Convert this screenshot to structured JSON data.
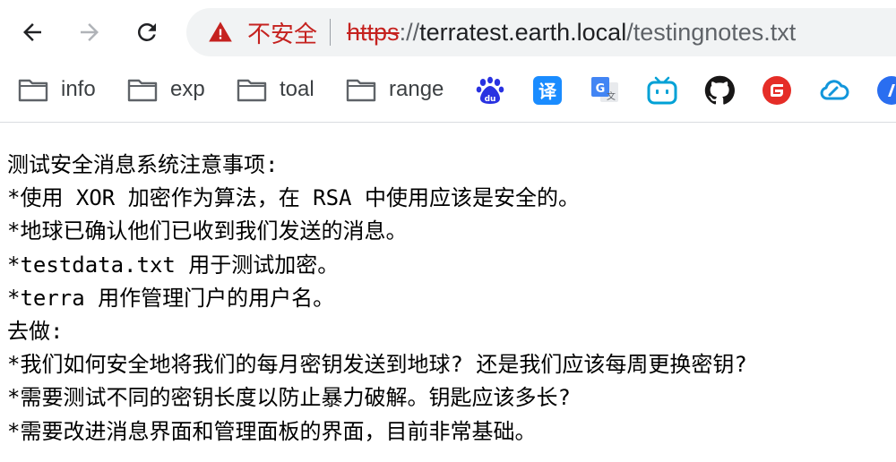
{
  "browser": {
    "security_label": "不安全",
    "url": {
      "scheme": "https",
      "separator": "://",
      "host": "terratest.earth.local",
      "path": "/testingnotes.txt"
    }
  },
  "bookmarks": {
    "folders": [
      {
        "label": "info"
      },
      {
        "label": "exp"
      },
      {
        "label": "toal"
      },
      {
        "label": "range"
      }
    ],
    "extensions": [
      "baidu-icon",
      "translate-icon",
      "google-translate-icon",
      "bilibili-icon",
      "github-icon",
      "gitee-icon",
      "cloud-icon",
      "partial-app-icon"
    ]
  },
  "document": {
    "lines": [
      "测试安全消息系统注意事项:",
      "*使用 XOR 加密作为算法，在 RSA 中使用应该是安全的。",
      "*地球已确认他们已收到我们发送的消息。",
      "*testdata.txt 用于测试加密。",
      "*terra 用作管理门户的用户名。",
      "去做:",
      "*我们如何安全地将我们的每月密钥发送到地球? 还是我们应该每周更换密钥?",
      "*需要测试不同的密钥长度以防止暴力破解。钥匙应该多长?",
      "*需要改进消息界面和管理面板的界面，目前非常基础。"
    ]
  },
  "colors": {
    "warning_red": "#c5221f",
    "omnibox_bg": "#f1f3f4",
    "text": "#000000"
  }
}
